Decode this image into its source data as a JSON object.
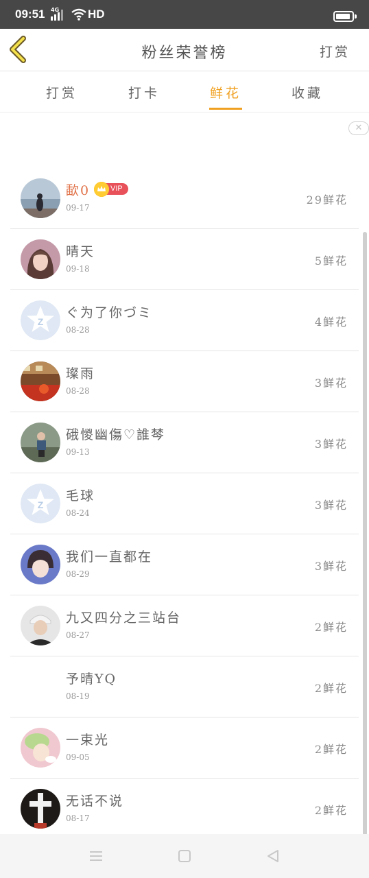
{
  "status_bar": {
    "time": "09:51",
    "network": "4G",
    "hd": "HD"
  },
  "header": {
    "title": "粉丝荣誉榜",
    "action": "打赏",
    "back_icon": "chevron-left-icon"
  },
  "tabs": [
    {
      "label": "打赏",
      "active": false
    },
    {
      "label": "打卡",
      "active": false
    },
    {
      "label": "鲜花",
      "active": true
    },
    {
      "label": "收藏",
      "active": false
    }
  ],
  "close_label": "✕",
  "vip_label": "VIP",
  "rows": [
    {
      "name": "歃0",
      "date": "09-17",
      "count": "29鲜花",
      "vip": true
    },
    {
      "name": "晴天",
      "date": "09-18",
      "count": "5鲜花"
    },
    {
      "name": "ぐ为了你づミ",
      "date": "08-28",
      "count": "4鲜花"
    },
    {
      "name": "璨雨",
      "date": "08-28",
      "count": "3鲜花"
    },
    {
      "name": "硪惾幽傷♡誰棽",
      "date": "09-13",
      "count": "3鲜花"
    },
    {
      "name": "毛球",
      "date": "08-24",
      "count": "3鲜花"
    },
    {
      "name": "我们一直都在",
      "date": "08-29",
      "count": "3鲜花"
    },
    {
      "name": "九又四分之三站台",
      "date": "08-27",
      "count": "2鲜花"
    },
    {
      "name": "予晴YQ",
      "date": "08-19",
      "count": "2鲜花"
    },
    {
      "name": "一束光",
      "date": "09-05",
      "count": "2鲜花"
    },
    {
      "name": "无话不说",
      "date": "08-17",
      "count": "2鲜花"
    }
  ],
  "colors": {
    "accent": "#f0a020",
    "highlight_name": "#e07046",
    "vip": "#e8505a"
  },
  "nav": {
    "menu_icon": "menu-icon",
    "home_icon": "home-square-icon",
    "back_icon": "back-triangle-icon"
  }
}
